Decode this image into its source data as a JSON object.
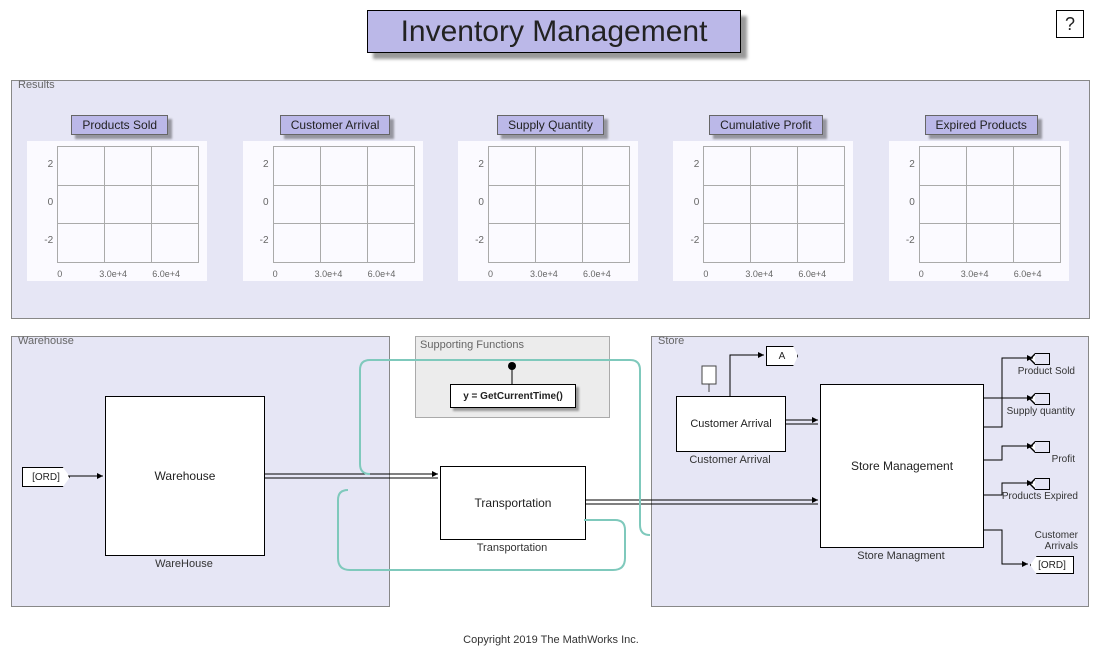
{
  "title": "Inventory Management",
  "help": "?",
  "panels": {
    "results": "Results",
    "warehouse": "Warehouse",
    "store": "Store",
    "support": "Supporting Functions"
  },
  "charts": [
    {
      "title": "Products Sold"
    },
    {
      "title": "Customer Arrival"
    },
    {
      "title": "Supply Quantity"
    },
    {
      "title": "Cumulative Profit"
    },
    {
      "title": "Expired Products"
    }
  ],
  "chart_axes": {
    "yticks": [
      "2",
      "0",
      "-2"
    ],
    "xticks": [
      "0",
      "3.0e+4",
      "6.0e+4"
    ]
  },
  "blocks": {
    "warehouse": {
      "label": "Warehouse",
      "under": "WareHouse"
    },
    "transport": {
      "label": "Transportation",
      "under": "Transportation"
    },
    "storeMgmt": {
      "label": "Store Management",
      "under": "Store Managment"
    },
    "customer": {
      "label": "Customer Arrival",
      "under": "Customer Arrival"
    },
    "func": "y = GetCurrentTime()"
  },
  "tags": {
    "ord_in": "[ORD]",
    "a": "A",
    "ord_out": "[ORD]"
  },
  "outputs": [
    "Product Sold",
    "Supply quantity",
    "Profit",
    "Products Expired",
    "Customer Arrivals"
  ],
  "copyright": "Copyright 2019 The MathWorks Inc.",
  "chart_data": {
    "type": "line",
    "note": "Five identical empty axes; no plotted series visible.",
    "series": [],
    "xlim": [
      0,
      60000
    ],
    "ylim": [
      -3,
      3
    ],
    "xticks": [
      0,
      30000,
      60000
    ],
    "yticks": [
      -2,
      0,
      2
    ],
    "titles": [
      "Products Sold",
      "Customer Arrival",
      "Supply Quantity",
      "Cumulative Profit",
      "Expired Products"
    ]
  }
}
